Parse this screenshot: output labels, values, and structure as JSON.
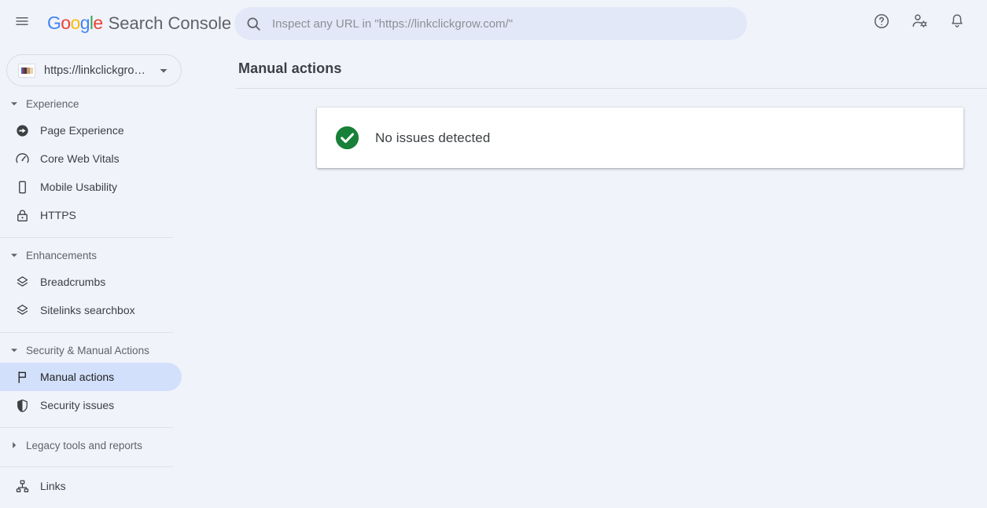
{
  "app": {
    "brand_google": "Google",
    "brand_product": "Search Console"
  },
  "header": {
    "menu_icon": "hamburger-menu-icon",
    "help_icon": "help-circle-icon",
    "account_settings_icon": "person-gear-icon",
    "notifications_icon": "bell-icon"
  },
  "search": {
    "icon": "search-icon",
    "placeholder": "Inspect any URL in \"https://linkclickgrow.com/\"",
    "value": ""
  },
  "property": {
    "favicon": "site-favicon",
    "label": "https://linkclickgro…",
    "full_url": "https://linkclickgrow.com/",
    "caret_icon": "chevron-down-icon"
  },
  "sidebar": {
    "sections": [
      {
        "title": "Experience",
        "expanded": true,
        "caret_icon": "caret-down-icon",
        "items": [
          {
            "label": "Page Experience",
            "icon": "page-experience-icon",
            "selected": false
          },
          {
            "label": "Core Web Vitals",
            "icon": "speedometer-icon",
            "selected": false
          },
          {
            "label": "Mobile Usability",
            "icon": "mobile-phone-icon",
            "selected": false
          },
          {
            "label": "HTTPS",
            "icon": "lock-icon",
            "selected": false
          }
        ]
      },
      {
        "title": "Enhancements",
        "expanded": true,
        "caret_icon": "caret-down-icon",
        "items": [
          {
            "label": "Breadcrumbs",
            "icon": "layers-icon",
            "selected": false
          },
          {
            "label": "Sitelinks searchbox",
            "icon": "layers-icon",
            "selected": false
          }
        ]
      },
      {
        "title": "Security & Manual Actions",
        "expanded": true,
        "caret_icon": "caret-down-icon",
        "items": [
          {
            "label": "Manual actions",
            "icon": "flag-icon",
            "selected": true
          },
          {
            "label": "Security issues",
            "icon": "shield-icon",
            "selected": false
          }
        ]
      }
    ],
    "legacy": {
      "title": "Legacy tools and reports",
      "expanded": false,
      "caret_icon": "caret-right-icon"
    },
    "links": {
      "label": "Links",
      "icon": "account-tree-icon"
    }
  },
  "main": {
    "page_title": "Manual actions",
    "status_card": {
      "icon": "check-circle-icon",
      "message": "No issues detected"
    }
  },
  "colors": {
    "page_background": "#f1f3fb",
    "selected_nav": "#d3e0fb",
    "search_field": "#e3e8f8",
    "success_green": "#188038",
    "card_white": "#ffffff",
    "text_primary": "#3c4043",
    "text_secondary": "#5f6368",
    "google_blue": "#4285F4",
    "google_red": "#EA4335",
    "google_yellow": "#FBBC05",
    "google_green": "#34A853"
  }
}
